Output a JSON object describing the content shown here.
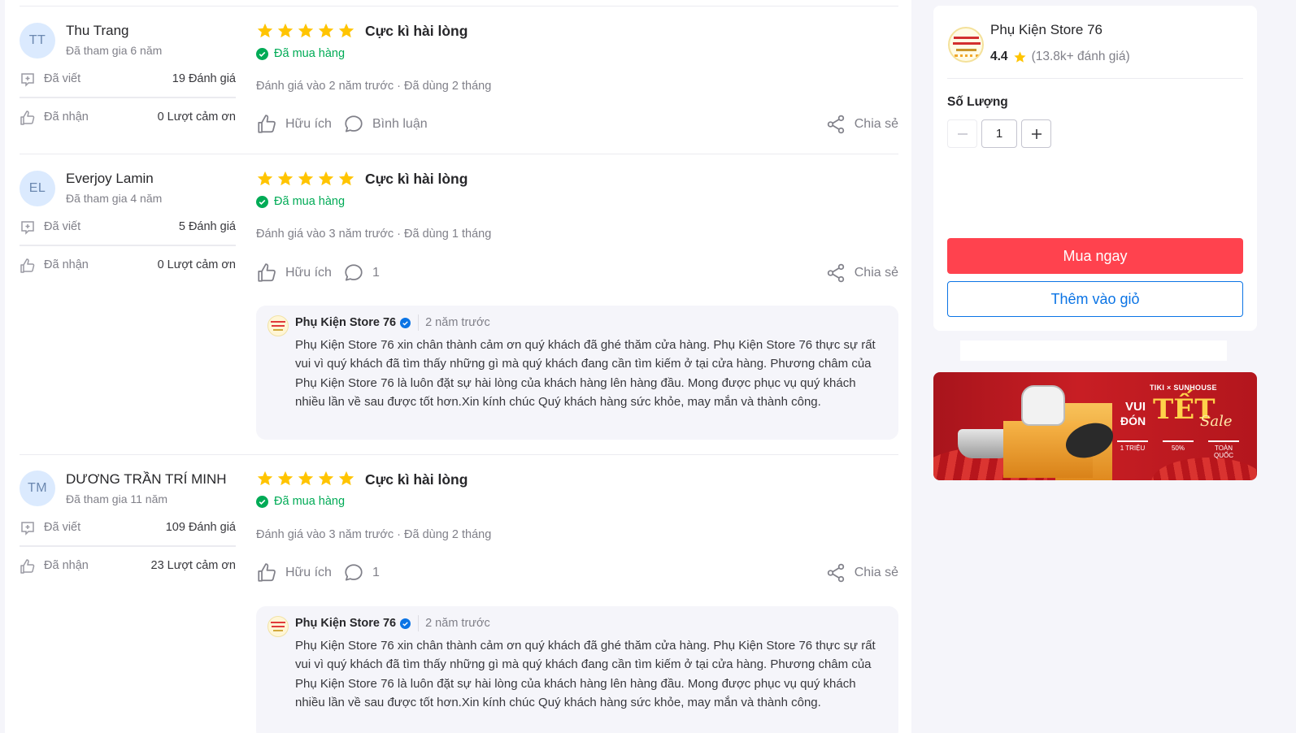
{
  "reviews": [
    {
      "initials": "TT",
      "name": "Thu Trang",
      "joined": "Đã tham gia 6 năm",
      "written_label": "Đã viết",
      "written_value": "19 Đánh giá",
      "thanks_label": "Đã nhận",
      "thanks_value": "0 Lượt cảm ơn",
      "stars": 5,
      "verdict": "Cực kì hài lòng",
      "bought": "Đã mua hàng",
      "reviewed": "Đánh giá vào 2 năm trước",
      "used": "Đã dùng 2 tháng",
      "helpful": "Hữu ích",
      "comment": "Bình luận",
      "share": "Chia sẻ"
    },
    {
      "initials": "EL",
      "name": "Everjoy Lamin",
      "joined": "Đã tham gia 4 năm",
      "written_label": "Đã viết",
      "written_value": "5 Đánh giá",
      "thanks_label": "Đã nhận",
      "thanks_value": "0 Lượt cảm ơn",
      "stars": 5,
      "verdict": "Cực kì hài lòng",
      "bought": "Đã mua hàng",
      "reviewed": "Đánh giá vào 3 năm trước",
      "used": "Đã dùng 1 tháng",
      "helpful": "Hữu ích",
      "comment": "1",
      "share": "Chia sẻ",
      "reply": {
        "store": "Phụ Kiện Store 76",
        "time": "2 năm trước",
        "text": "Phụ Kiện Store 76 xin chân thành cảm ơn quý khách đã ghé thăm cửa hàng. Phụ Kiện Store 76 thực sự rất vui vì quý khách đã tìm thấy những gì mà quý khách đang cần tìm kiếm ở tại cửa hàng. Phương châm của Phụ Kiện Store 76 là luôn đặt sự hài lòng của khách hàng lên hàng đầu. Mong được phục vụ quý khách nhiều lần về sau được tốt hơn.Xin kính chúc Quý khách hàng sức khỏe, may mắn và thành công."
      }
    },
    {
      "initials": "TM",
      "name": "DƯƠNG TRẦN TRÍ MINH",
      "joined": "Đã tham gia 11 năm",
      "written_label": "Đã viết",
      "written_value": "109 Đánh giá",
      "thanks_label": "Đã nhận",
      "thanks_value": "23 Lượt cảm ơn",
      "stars": 5,
      "verdict": "Cực kì hài lòng",
      "bought": "Đã mua hàng",
      "reviewed": "Đánh giá vào 3 năm trước",
      "used": "Đã dùng 2 tháng",
      "helpful": "Hữu ích",
      "comment": "1",
      "share": "Chia sẻ",
      "reply": {
        "store": "Phụ Kiện Store 76",
        "time": "2 năm trước",
        "text": "Phụ Kiện Store 76 xin chân thành cảm ơn quý khách đã ghé thăm cửa hàng. Phụ Kiện Store 76 thực sự rất vui vì quý khách đã tìm thấy những gì mà quý khách đang cần tìm kiếm ở tại cửa hàng. Phương châm của Phụ Kiện Store 76 là luôn đặt sự hài lòng của khách hàng lên hàng đầu. Mong được phục vụ quý khách nhiều lần về sau được tốt hơn.Xin kính chúc Quý khách hàng sức khỏe, may mắn và thành công."
      }
    }
  ],
  "sidebar": {
    "store_name": "Phụ Kiện Store 76",
    "rating": "4.4",
    "rating_count": "(13.8k+ đánh giá)",
    "quantity_label": "Số Lượng",
    "quantity": "1",
    "buy_now": "Mua ngay",
    "add_to_cart": "Thêm vào giỏ"
  },
  "banner": {
    "brand": "TIKI × SUNHOUSE",
    "line1": "VUI",
    "line2": "ĐÓN",
    "tet": "TẾT",
    "sale": "Sale",
    "offer1": "1 TRIỆU",
    "offer2": "50%",
    "offer3": "TOÀN QUỐC"
  },
  "colors": {
    "star": "#ffc400",
    "verified_green": "#00ab56",
    "buy_red": "#ff424e",
    "link_blue": "#0b74e5"
  }
}
